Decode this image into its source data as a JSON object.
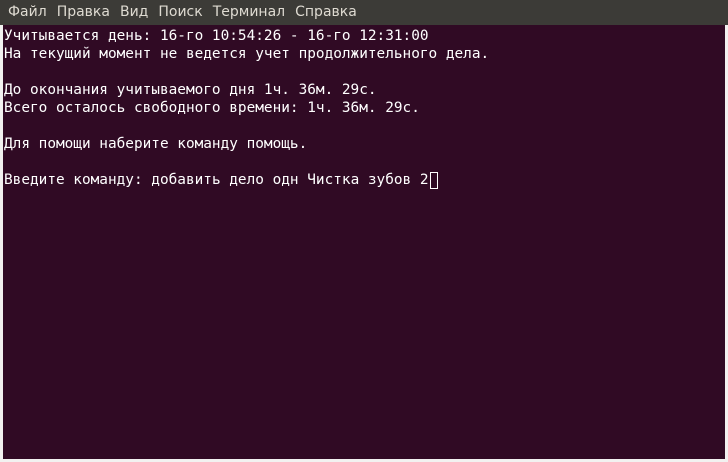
{
  "menu": {
    "items": [
      "Файл",
      "Правка",
      "Вид",
      "Поиск",
      "Терминал",
      "Справка"
    ]
  },
  "terminal": {
    "lines": [
      "Учитывается день: 16-го 10:54:26 - 16-го 12:31:00",
      "На текущий момент не ведется учет продолжительного дела.",
      "",
      "До окончания учитываемого дня 1ч. 36м. 29с.",
      "Всего осталось свободного времени: 1ч. 36м. 29с.",
      "",
      "Для помощи наберите команду помощь.",
      ""
    ],
    "prompt": "Введите команду: ",
    "input": "добавить дело одн Чистка зубов 2"
  },
  "colors": {
    "menubar_bg": "#3c3b37",
    "menu_text": "#dfdbd2",
    "terminal_bg": "#300a24",
    "terminal_text": "#ffffff"
  }
}
